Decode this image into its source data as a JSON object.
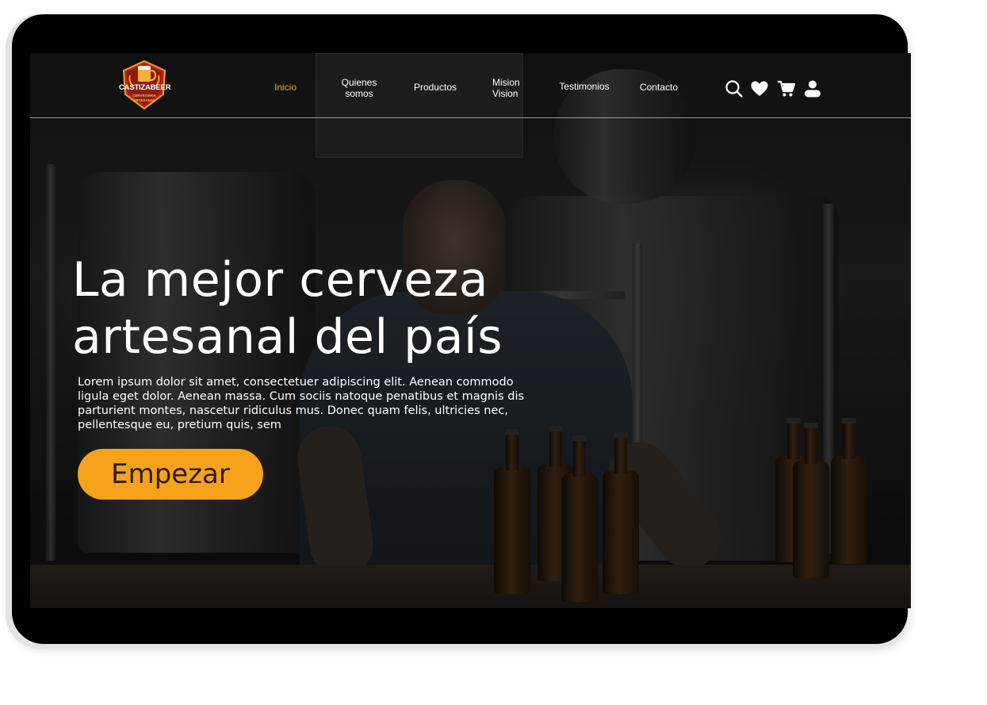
{
  "brand": {
    "logo_name": "CASTIZABEER",
    "logo_tagline_1": "CERVECERIA",
    "logo_tagline_2": "ARTESANAL"
  },
  "nav": {
    "items": [
      {
        "label": "Inicio",
        "active": true
      },
      {
        "label_line1": "Quienes",
        "label_line2": "somos"
      },
      {
        "label": "Productos"
      },
      {
        "label_line1": "Mision",
        "label_line2": "Vision"
      },
      {
        "label": "Testimonios"
      },
      {
        "label": "Contacto"
      }
    ],
    "icons": [
      "search-icon",
      "heart-icon",
      "cart-icon",
      "user-icon"
    ]
  },
  "hero": {
    "title_line1": "La mejor cerveza",
    "title_line2": "artesanal del país",
    "body": "Lorem ipsum dolor sit amet, consectetuer adipiscing elit. Aenean commodo ligula eget dolor. Aenean massa. Cum sociis natoque penatibus et magnis dis parturient montes, nascetur ridiculus mus. Donec quam felis, ultricies nec, pellentesque eu, pretium quis, sem",
    "cta_label": "Empezar"
  },
  "colors": {
    "accent": "#f7a21b",
    "text": "#ffffff",
    "background": "#000000"
  }
}
